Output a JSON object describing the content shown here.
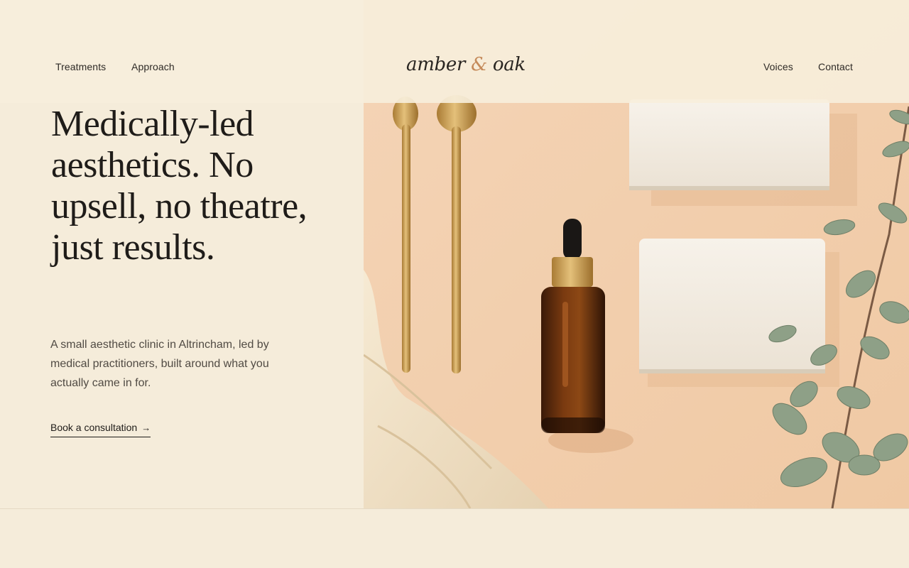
{
  "nav": {
    "left": [
      "Treatments",
      "Approach"
    ],
    "right": [
      "Voices",
      "Contact"
    ]
  },
  "brand": {
    "name_part1": "amber",
    "ampersand": "&",
    "name_part2": "oak"
  },
  "hero": {
    "headline": "Medically-led aesthetics. No upsell, no theatre, just results.",
    "intro": "A small aesthetic clinic in Altrincham, led by medical practitioners, built around what you actually came in for.",
    "cta_label": "Book a consultation",
    "cta_icon": "arrow-right-icon",
    "image": "flat-lay photo: gold spoons, amber dropper bottle, white towels, eucalyptus"
  },
  "colors": {
    "background": "#f5ecda",
    "accent": "#c58a5a",
    "text": "#1f1c19",
    "photo_bg": "#f3cfae"
  }
}
